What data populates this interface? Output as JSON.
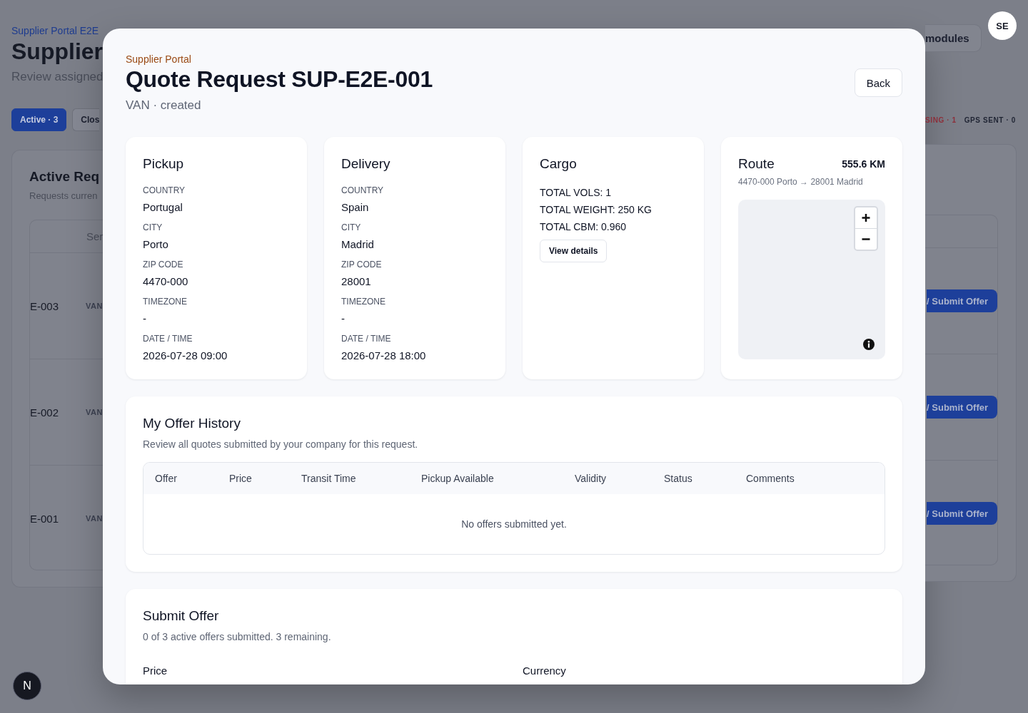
{
  "background": {
    "breadcrumb": "Supplier Portal E2E",
    "title": "Supplier",
    "subtitle": "Review assigned",
    "filters": [
      {
        "label": "Active · 3",
        "selected": true
      },
      {
        "label": "Clos",
        "selected": false
      }
    ],
    "modules_button": "modules",
    "avatar": "SE",
    "stats": [
      {
        "label": "SING · 1",
        "color": "#8c2f3a"
      },
      {
        "label": "GPS SENT · 0",
        "color": "#1f2433"
      }
    ],
    "panel": {
      "title": "Active Req",
      "subtitle": "Requests curren",
      "column": "Ser",
      "rows": [
        {
          "id": "E-003",
          "type": "VAN",
          "action": "/ Submit Offer"
        },
        {
          "id": "E-002",
          "type": "VAN",
          "action": "/ Submit Offer"
        },
        {
          "id": "E-001",
          "type": "VAN",
          "action": "/ Submit Offer"
        }
      ]
    }
  },
  "dev_badge": "N",
  "modal": {
    "eyebrow": "Supplier Portal",
    "title": "Quote Request SUP-E2E-001",
    "subtitle": "VAN · created",
    "back_button": "Back",
    "location_cards": [
      {
        "title": "Pickup",
        "fields": [
          {
            "label": "COUNTRY",
            "value": "Portugal"
          },
          {
            "label": "CITY",
            "value": "Porto"
          },
          {
            "label": "ZIP CODE",
            "value": "4470-000"
          },
          {
            "label": "TIMEZONE",
            "value": "-"
          },
          {
            "label": "DATE / TIME",
            "value": "2026-07-28 09:00"
          }
        ]
      },
      {
        "title": "Delivery",
        "fields": [
          {
            "label": "COUNTRY",
            "value": "Spain"
          },
          {
            "label": "CITY",
            "value": "Madrid"
          },
          {
            "label": "ZIP CODE",
            "value": "28001"
          },
          {
            "label": "TIMEZONE",
            "value": "-"
          },
          {
            "label": "DATE / TIME",
            "value": "2026-07-28 18:00"
          }
        ]
      }
    ],
    "cargo": {
      "title": "Cargo",
      "lines": [
        "TOTAL VOLS: 1",
        "TOTAL WEIGHT: 250 KG",
        "TOTAL CBM: 0.960"
      ],
      "button": "View details"
    },
    "route": {
      "title": "Route",
      "distance": "555.6 KM",
      "path": "4470-000 Porto → 28001 Madrid"
    },
    "offer_history": {
      "title": "My Offer History",
      "description": "Review all quotes submitted by your company for this request.",
      "columns": [
        "Offer",
        "Price",
        "Transit Time",
        "Pickup Available",
        "Validity",
        "Status",
        "Comments"
      ],
      "empty_message": "No offers submitted yet."
    },
    "submit_offer": {
      "title": "Submit Offer",
      "description": "0 of 3 active offers submitted. 3 remaining.",
      "fields": [
        {
          "label": "Price"
        },
        {
          "label": "Currency"
        }
      ]
    }
  }
}
